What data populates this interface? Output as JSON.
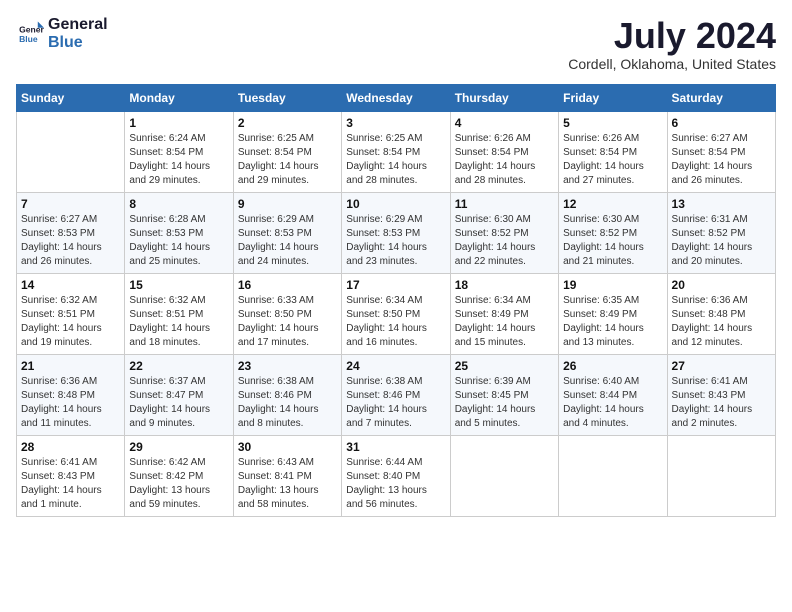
{
  "logo": {
    "line1": "General",
    "line2": "Blue"
  },
  "title": "July 2024",
  "location": "Cordell, Oklahoma, United States",
  "days_of_week": [
    "Sunday",
    "Monday",
    "Tuesday",
    "Wednesday",
    "Thursday",
    "Friday",
    "Saturday"
  ],
  "weeks": [
    [
      {
        "num": "",
        "info": ""
      },
      {
        "num": "1",
        "info": "Sunrise: 6:24 AM\nSunset: 8:54 PM\nDaylight: 14 hours\nand 29 minutes."
      },
      {
        "num": "2",
        "info": "Sunrise: 6:25 AM\nSunset: 8:54 PM\nDaylight: 14 hours\nand 29 minutes."
      },
      {
        "num": "3",
        "info": "Sunrise: 6:25 AM\nSunset: 8:54 PM\nDaylight: 14 hours\nand 28 minutes."
      },
      {
        "num": "4",
        "info": "Sunrise: 6:26 AM\nSunset: 8:54 PM\nDaylight: 14 hours\nand 28 minutes."
      },
      {
        "num": "5",
        "info": "Sunrise: 6:26 AM\nSunset: 8:54 PM\nDaylight: 14 hours\nand 27 minutes."
      },
      {
        "num": "6",
        "info": "Sunrise: 6:27 AM\nSunset: 8:54 PM\nDaylight: 14 hours\nand 26 minutes."
      }
    ],
    [
      {
        "num": "7",
        "info": "Sunrise: 6:27 AM\nSunset: 8:53 PM\nDaylight: 14 hours\nand 26 minutes."
      },
      {
        "num": "8",
        "info": "Sunrise: 6:28 AM\nSunset: 8:53 PM\nDaylight: 14 hours\nand 25 minutes."
      },
      {
        "num": "9",
        "info": "Sunrise: 6:29 AM\nSunset: 8:53 PM\nDaylight: 14 hours\nand 24 minutes."
      },
      {
        "num": "10",
        "info": "Sunrise: 6:29 AM\nSunset: 8:53 PM\nDaylight: 14 hours\nand 23 minutes."
      },
      {
        "num": "11",
        "info": "Sunrise: 6:30 AM\nSunset: 8:52 PM\nDaylight: 14 hours\nand 22 minutes."
      },
      {
        "num": "12",
        "info": "Sunrise: 6:30 AM\nSunset: 8:52 PM\nDaylight: 14 hours\nand 21 minutes."
      },
      {
        "num": "13",
        "info": "Sunrise: 6:31 AM\nSunset: 8:52 PM\nDaylight: 14 hours\nand 20 minutes."
      }
    ],
    [
      {
        "num": "14",
        "info": "Sunrise: 6:32 AM\nSunset: 8:51 PM\nDaylight: 14 hours\nand 19 minutes."
      },
      {
        "num": "15",
        "info": "Sunrise: 6:32 AM\nSunset: 8:51 PM\nDaylight: 14 hours\nand 18 minutes."
      },
      {
        "num": "16",
        "info": "Sunrise: 6:33 AM\nSunset: 8:50 PM\nDaylight: 14 hours\nand 17 minutes."
      },
      {
        "num": "17",
        "info": "Sunrise: 6:34 AM\nSunset: 8:50 PM\nDaylight: 14 hours\nand 16 minutes."
      },
      {
        "num": "18",
        "info": "Sunrise: 6:34 AM\nSunset: 8:49 PM\nDaylight: 14 hours\nand 15 minutes."
      },
      {
        "num": "19",
        "info": "Sunrise: 6:35 AM\nSunset: 8:49 PM\nDaylight: 14 hours\nand 13 minutes."
      },
      {
        "num": "20",
        "info": "Sunrise: 6:36 AM\nSunset: 8:48 PM\nDaylight: 14 hours\nand 12 minutes."
      }
    ],
    [
      {
        "num": "21",
        "info": "Sunrise: 6:36 AM\nSunset: 8:48 PM\nDaylight: 14 hours\nand 11 minutes."
      },
      {
        "num": "22",
        "info": "Sunrise: 6:37 AM\nSunset: 8:47 PM\nDaylight: 14 hours\nand 9 minutes."
      },
      {
        "num": "23",
        "info": "Sunrise: 6:38 AM\nSunset: 8:46 PM\nDaylight: 14 hours\nand 8 minutes."
      },
      {
        "num": "24",
        "info": "Sunrise: 6:38 AM\nSunset: 8:46 PM\nDaylight: 14 hours\nand 7 minutes."
      },
      {
        "num": "25",
        "info": "Sunrise: 6:39 AM\nSunset: 8:45 PM\nDaylight: 14 hours\nand 5 minutes."
      },
      {
        "num": "26",
        "info": "Sunrise: 6:40 AM\nSunset: 8:44 PM\nDaylight: 14 hours\nand 4 minutes."
      },
      {
        "num": "27",
        "info": "Sunrise: 6:41 AM\nSunset: 8:43 PM\nDaylight: 14 hours\nand 2 minutes."
      }
    ],
    [
      {
        "num": "28",
        "info": "Sunrise: 6:41 AM\nSunset: 8:43 PM\nDaylight: 14 hours\nand 1 minute."
      },
      {
        "num": "29",
        "info": "Sunrise: 6:42 AM\nSunset: 8:42 PM\nDaylight: 13 hours\nand 59 minutes."
      },
      {
        "num": "30",
        "info": "Sunrise: 6:43 AM\nSunset: 8:41 PM\nDaylight: 13 hours\nand 58 minutes."
      },
      {
        "num": "31",
        "info": "Sunrise: 6:44 AM\nSunset: 8:40 PM\nDaylight: 13 hours\nand 56 minutes."
      },
      {
        "num": "",
        "info": ""
      },
      {
        "num": "",
        "info": ""
      },
      {
        "num": "",
        "info": ""
      }
    ]
  ]
}
